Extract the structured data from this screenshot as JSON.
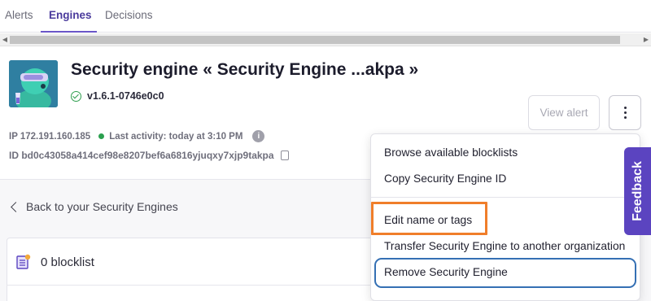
{
  "tabs": [
    {
      "label": "Alerts"
    },
    {
      "label": "Engines"
    },
    {
      "label": "Decisions"
    }
  ],
  "engine": {
    "title": "Security engine « Security Engine ...akpa »",
    "version": "v1.6.1-0746e0c0",
    "ip": "IP 172.191.160.185",
    "last_activity": "Last activity: today at 3:10 PM",
    "id": "ID bd0c43058a414cef98e8207bef6a6816yjuqxy7xjp9takpa"
  },
  "actions": {
    "view_alert": "View alert"
  },
  "back_link": "Back to your Security Engines",
  "blocklist": {
    "label": "0 blocklist"
  },
  "menu": {
    "items": [
      {
        "label": "Browse available blocklists"
      },
      {
        "label": "Copy Security Engine ID"
      },
      {
        "label": "Edit name or tags"
      },
      {
        "label": "Transfer Security Engine to another organization"
      },
      {
        "label": "Remove Security Engine"
      }
    ]
  },
  "feedback": {
    "label": "Feedback"
  },
  "colors": {
    "accent": "#5b44c0",
    "status_green": "#2ba04f",
    "highlight_orange": "#f07e2a",
    "focus_blue": "#3570b4"
  }
}
